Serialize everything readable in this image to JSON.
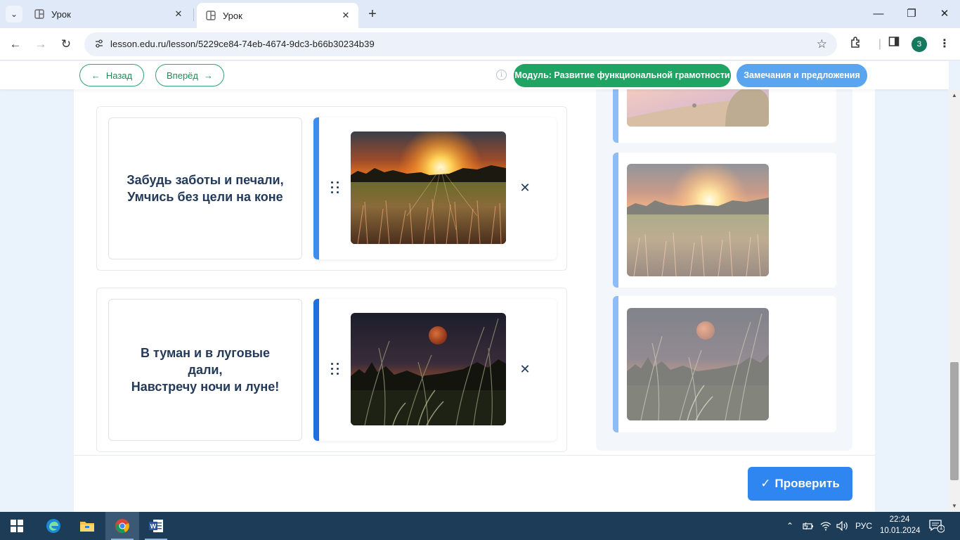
{
  "browser": {
    "tabs": [
      {
        "title": "Урок",
        "active": false
      },
      {
        "title": "Урок",
        "active": true
      }
    ],
    "url": "lesson.edu.ru/lesson/5229ce84-74eb-4674-9dc3-b66b30234b39",
    "profile_initial": "З"
  },
  "header": {
    "back_label": "Назад",
    "forward_label": "Вперёд",
    "module_label": "Модуль: Развитие функциональной грамотности",
    "feedback_label": "Замечания и предложения"
  },
  "pairs": [
    {
      "lines": [
        "Забудь заботы и печали,",
        "Умчись без цели на коне"
      ],
      "image": "sunset-field-image"
    },
    {
      "lines": [
        "В туман и в луговые",
        "дали,",
        "Навстречу ночи и луне!"
      ],
      "image": "moon-grass-image"
    }
  ],
  "bank": [
    "haystack-sunset-image",
    "sunset-field-image",
    "moon-grass-image"
  ],
  "actions": {
    "check_label": "Проверить"
  },
  "taskbar": {
    "apps": [
      "windows-start",
      "edge",
      "file-explorer",
      "chrome",
      "word"
    ],
    "language": "РУС",
    "time": "22:24",
    "date": "10.01.2024",
    "notification_count": "1"
  },
  "colors": {
    "green": "#1fa463",
    "blue": "#2f86f0",
    "light_blue": "#5aa5ef",
    "text_dark": "#233a5a"
  }
}
